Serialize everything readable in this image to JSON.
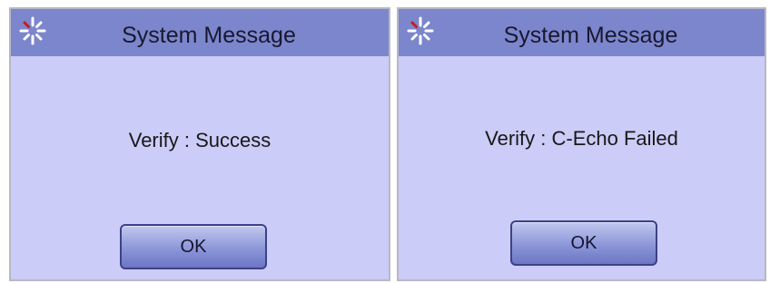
{
  "dialogs": [
    {
      "title": "System Message",
      "icon": "spinner-icon",
      "message": "Verify : Success",
      "ok_label": "OK"
    },
    {
      "title": "System Message",
      "icon": "spinner-icon",
      "message": "Verify : C-Echo Failed",
      "ok_label": "OK"
    }
  ],
  "colors": {
    "titlebar": "#7c86cc",
    "dialog_body": "#ccccf8",
    "icon_spokes": "#ffffff",
    "icon_highlight": "#cc1a1a"
  }
}
